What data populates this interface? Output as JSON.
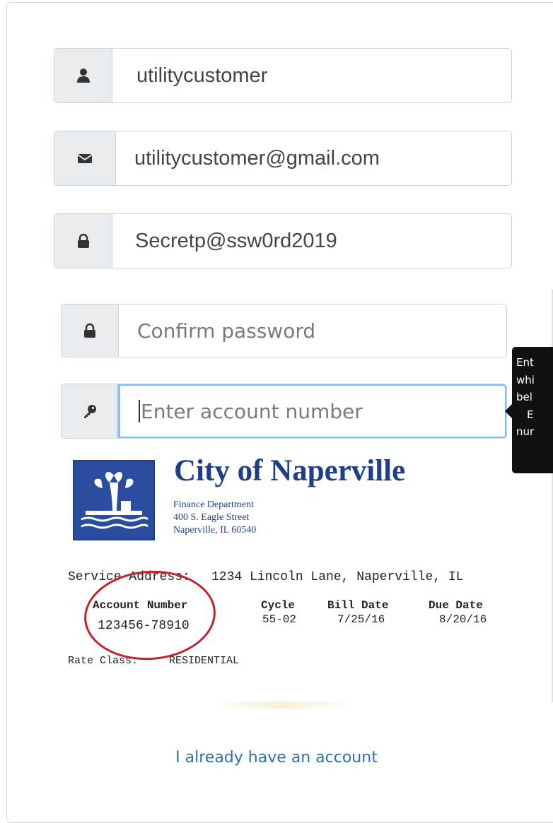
{
  "form": {
    "username": {
      "value": "utilitycustomer",
      "icon": "user-icon"
    },
    "email": {
      "value": "utilitycustomer@gmail.com",
      "icon": "envelope-icon"
    },
    "password": {
      "value": "Secretp@ssw0rd2019",
      "icon": "lock-icon"
    },
    "confirm_password": {
      "placeholder": "Confirm password",
      "icon": "lock-icon"
    },
    "account_number": {
      "placeholder": "Enter account number",
      "icon": "key-icon"
    }
  },
  "tooltip": {
    "lines": [
      "Ent",
      "whi",
      "bel",
      "E",
      "nur"
    ]
  },
  "bill": {
    "city": "City of Naperville",
    "dept": "Finance Department",
    "street": "400 S. Eagle Street",
    "citystate": "Naperville, IL 60540",
    "service_address_label": "Service Address:",
    "service_address_value": "1234 Lincoln Lane, Naperville, IL",
    "account_number_label": "Account Number",
    "account_number_value": "123456-78910",
    "cycle_label": "Cycle",
    "cycle_value": "55-02",
    "bill_date_label": "Bill Date",
    "bill_date_value": "7/25/16",
    "due_date_label": "Due Date",
    "due_date_value": "8/20/16",
    "rate_class_label": "Rate Class:",
    "rate_class_value": "RESIDENTIAL"
  },
  "login_link": "I already have an account",
  "colors": {
    "accent": "#80bdff",
    "link": "#2f6fa7",
    "bill_blue": "#1f3e8a",
    "circle_red": "#c4222c"
  }
}
